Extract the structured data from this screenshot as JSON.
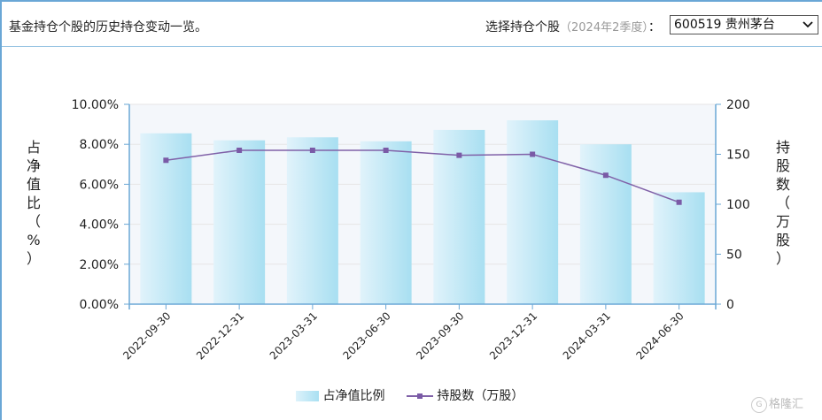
{
  "header": {
    "title": "基金持仓个股的历史持仓变动一览。",
    "select_label": "选择持仓个股",
    "select_period": "（2024年2季度）",
    "select_colon": "：",
    "selected_stock": "600519 贵州茅台"
  },
  "colors": {
    "bar_light": "#ddf2fb",
    "bar_dark": "#a9e0f2",
    "line": "#8061a8",
    "axis": "#6aa7d6",
    "grid": "#e6e6e6",
    "plot_bg": "#f4f7fb"
  },
  "icons": {
    "select_arrow": "chevron-down-icon"
  },
  "watermark": {
    "text": "格隆汇"
  },
  "chart_data": {
    "type": "bar",
    "categories": [
      "2022-09-30",
      "2022-12-31",
      "2023-03-31",
      "2023-06-30",
      "2023-09-30",
      "2023-12-31",
      "2024-03-31",
      "2024-06-30"
    ],
    "series": [
      {
        "name": "占净值比例",
        "type": "bar",
        "axis": "left",
        "values": [
          8.55,
          8.2,
          8.35,
          8.15,
          8.72,
          9.2,
          8.0,
          5.6
        ]
      },
      {
        "name": "持股数（万股）",
        "type": "line",
        "axis": "right",
        "values": [
          144,
          154,
          154,
          154,
          149,
          150,
          129,
          102
        ]
      }
    ],
    "ylabel_left": "占净值比（%）",
    "ylabel_right": "持股数（万股）",
    "ylim_left": [
      0,
      10
    ],
    "ylim_right": [
      0,
      200
    ],
    "yticks_left": [
      "0.00%",
      "2.00%",
      "4.00%",
      "6.00%",
      "8.00%",
      "10.00%"
    ],
    "yticks_right": [
      "0",
      "50",
      "100",
      "150",
      "200"
    ],
    "grid": true,
    "legend": "bottom-center"
  }
}
